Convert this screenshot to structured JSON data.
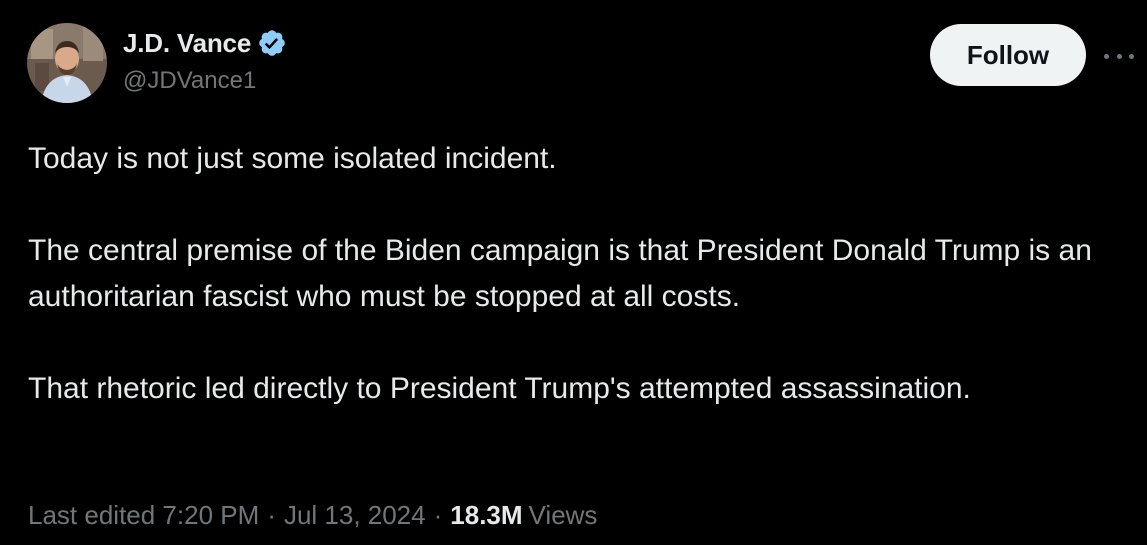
{
  "author": {
    "display_name": "J.D. Vance",
    "handle": "@JDVance1",
    "verified_icon": "verified-badge-icon"
  },
  "actions": {
    "follow_label": "Follow",
    "more_icon": "more-options-icon"
  },
  "tweet": {
    "paragraphs": [
      "Today is not just some isolated incident.",
      "The central premise of the Biden campaign is that President Donald Trump is an authoritarian fascist who must be stopped at all costs.",
      "That rhetoric led directly to President Trump's attempted assassination."
    ]
  },
  "meta": {
    "edited_time": "Last edited 7:20 PM",
    "separator": "·",
    "date": "Jul 13, 2024",
    "views_count": "18.3M",
    "views_label": "Views"
  },
  "colors": {
    "background": "#000000",
    "primary_text": "#e7e9ea",
    "secondary_text": "#71767b",
    "verified_blue": "#8ecdf8",
    "follow_bg": "#eff3f4"
  }
}
